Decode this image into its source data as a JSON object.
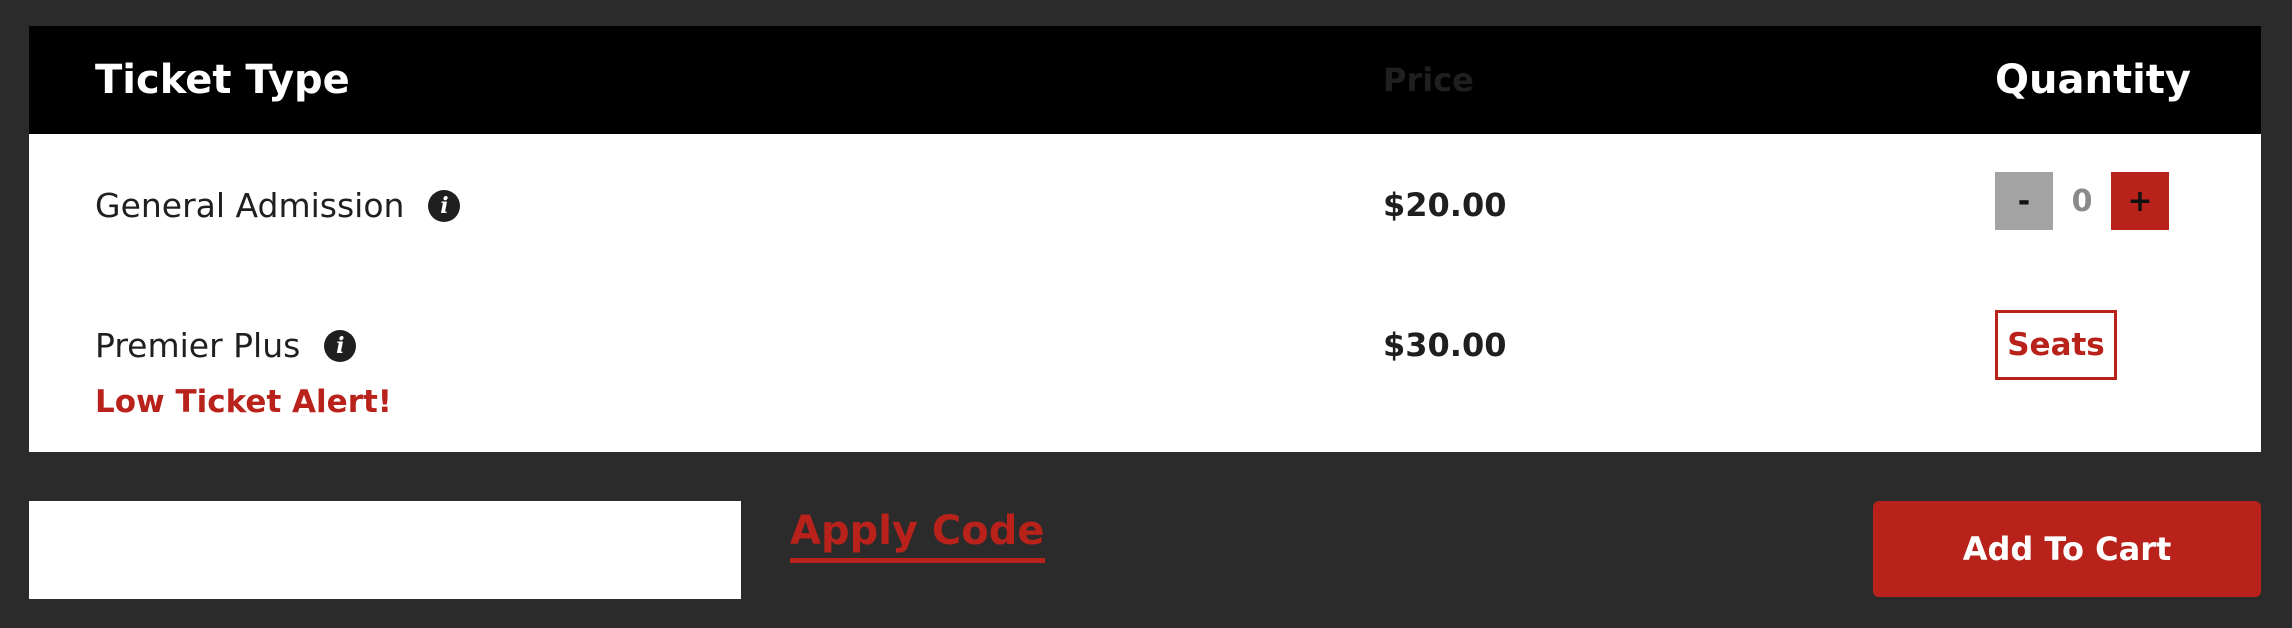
{
  "table": {
    "headers": {
      "type": "Ticket Type",
      "price": "Price",
      "quantity": "Quantity"
    },
    "rows": [
      {
        "name": "General Admission",
        "info_icon": "info-icon",
        "price": "$20.00",
        "quantity": {
          "minus_label": "-",
          "value": "0",
          "plus_label": "+"
        }
      },
      {
        "name": "Premier Plus",
        "info_icon": "info-icon",
        "alert": "Low Ticket Alert!",
        "price": "$30.00",
        "seats_label": "Seats"
      }
    ]
  },
  "promo": {
    "placeholder": "",
    "value": "",
    "apply_label": "Apply Code"
  },
  "cart": {
    "add_label": "Add To Cart"
  },
  "colors": {
    "background": "#2b2b2b",
    "header_bg": "#000000",
    "accent": "#b8221a",
    "minus_button": "#a3a3a3"
  }
}
